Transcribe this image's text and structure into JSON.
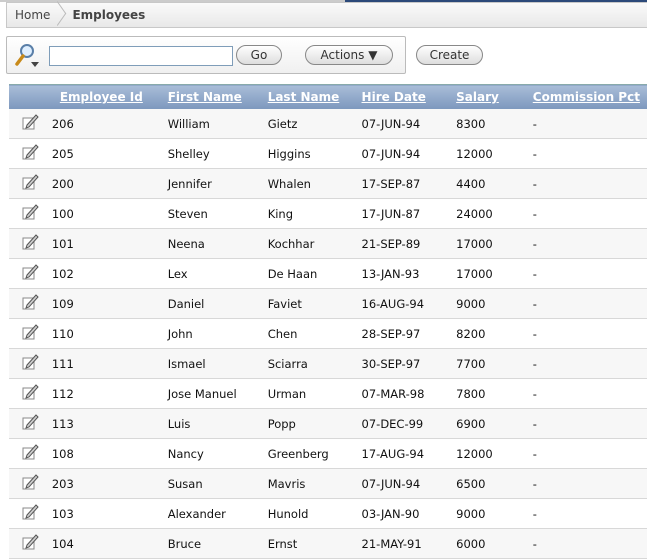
{
  "breadcrumb": {
    "home": "Home",
    "current": "Employees"
  },
  "search": {
    "value": "",
    "placeholder": "",
    "go": "Go",
    "actions": "Actions ▼",
    "create": "Create"
  },
  "columns": [
    "Employee Id",
    "First Name",
    "Last Name",
    "Hire Date",
    "Salary",
    "Commission Pct"
  ],
  "rows": [
    [
      "206",
      "William",
      "Gietz",
      "07-JUN-94",
      "8300",
      "-"
    ],
    [
      "205",
      "Shelley",
      "Higgins",
      "07-JUN-94",
      "12000",
      "-"
    ],
    [
      "200",
      "Jennifer",
      "Whalen",
      "17-SEP-87",
      "4400",
      "-"
    ],
    [
      "100",
      "Steven",
      "King",
      "17-JUN-87",
      "24000",
      "-"
    ],
    [
      "101",
      "Neena",
      "Kochhar",
      "21-SEP-89",
      "17000",
      "-"
    ],
    [
      "102",
      "Lex",
      "De Haan",
      "13-JAN-93",
      "17000",
      "-"
    ],
    [
      "109",
      "Daniel",
      "Faviet",
      "16-AUG-94",
      "9000",
      "-"
    ],
    [
      "110",
      "John",
      "Chen",
      "28-SEP-97",
      "8200",
      "-"
    ],
    [
      "111",
      "Ismael",
      "Sciarra",
      "30-SEP-97",
      "7700",
      "-"
    ],
    [
      "112",
      "Jose Manuel",
      "Urman",
      "07-MAR-98",
      "7800",
      "-"
    ],
    [
      "113",
      "Luis",
      "Popp",
      "07-DEC-99",
      "6900",
      "-"
    ],
    [
      "108",
      "Nancy",
      "Greenberg",
      "17-AUG-94",
      "12000",
      "-"
    ],
    [
      "203",
      "Susan",
      "Mavris",
      "07-JUN-94",
      "6500",
      "-"
    ],
    [
      "103",
      "Alexander",
      "Hunold",
      "03-JAN-90",
      "9000",
      "-"
    ],
    [
      "104",
      "Bruce",
      "Ernst",
      "21-MAY-91",
      "6000",
      "-"
    ]
  ]
}
